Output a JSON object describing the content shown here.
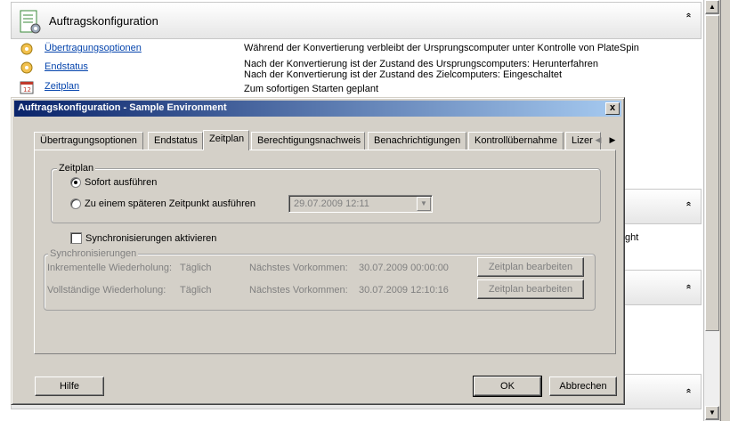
{
  "background": {
    "header_title": "Auftragskonfiguration",
    "rows": [
      {
        "icon": "settings-icon",
        "link": "Übertragungsoptionen"
      },
      {
        "icon": "settings-icon",
        "link": "Endstatus"
      },
      {
        "icon": "calendar-icon",
        "link": "Zeitplan"
      }
    ],
    "descriptions": [
      "Während der Konvertierung verbleibt der Ursprungscomputer unter Kontrolle von PlateSpin",
      "Nach der Konvertierung ist der Zustand des Ursprungscomputers: Herunterfahren",
      "Nach der Konvertierung ist der Zustand des Zielcomputers: Eingeschaltet",
      "Zum sofortigen Starten geplant"
    ],
    "partial_text": "ght",
    "collapse_glyph": "«"
  },
  "dialog": {
    "title": "Auftragskonfiguration - Sample Environment",
    "close_glyph": "x",
    "tabs": [
      {
        "label": "Übertragungsoptionen",
        "active": false
      },
      {
        "label": "Endstatus",
        "active": false
      },
      {
        "label": "Zeitplan",
        "active": true
      },
      {
        "label": "Berechtigungsnachweis",
        "active": false
      },
      {
        "label": "Benachrichtigungen",
        "active": false
      },
      {
        "label": "Kontrollübernahme",
        "active": false
      },
      {
        "label": "Lizer",
        "active": false
      }
    ],
    "tab_scroll": {
      "left": "◀",
      "right": "▶"
    },
    "schedule_group": {
      "legend": "Zeitplan",
      "option_now": "Sofort ausführen",
      "option_later": "Zu einem späteren Zeitpunkt ausführen",
      "selected": "now",
      "datetime_value": "29.07.2009 12:11",
      "dropdown_glyph": "▼"
    },
    "sync_checkbox": {
      "label": "Synchronisierungen aktivieren",
      "checked": false
    },
    "sync_group": {
      "legend": "Synchronisierungen",
      "rows": [
        {
          "label": "Inkrementelle Wiederholung:",
          "frequency": "Täglich",
          "next_label": "Nächstes Vorkommen:",
          "next_value": "30.07.2009 00:00:00",
          "button": "Zeitplan bearbeiten"
        },
        {
          "label": "Vollständige Wiederholung:",
          "frequency": "Täglich",
          "next_label": "Nächstes Vorkommen:",
          "next_value": "30.07.2009 12:10:16",
          "button": "Zeitplan bearbeiten"
        }
      ]
    },
    "buttons": {
      "help": "Hilfe",
      "ok": "OK",
      "cancel": "Abbrechen"
    }
  },
  "colors": {
    "titlebar_start": "#0a246a",
    "titlebar_end": "#a6caf0",
    "link": "#0645ad",
    "dialog_bg": "#d4d0c8"
  }
}
